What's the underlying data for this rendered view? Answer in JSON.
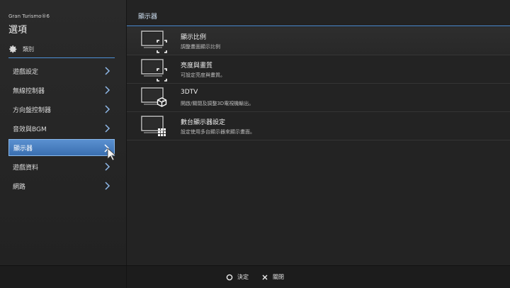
{
  "sidebar": {
    "app_name": "Gran Turismo®6",
    "title": "選項",
    "category_label": "類別",
    "items": [
      {
        "label": "遊戲設定"
      },
      {
        "label": "無線控制器"
      },
      {
        "label": "方向盤控制器"
      },
      {
        "label": "音效與BGM"
      },
      {
        "label": "顯示器",
        "selected": true
      },
      {
        "label": "遊戲資料"
      },
      {
        "label": "網路"
      }
    ]
  },
  "main": {
    "title": "顯示器",
    "options": [
      {
        "title": "顯示比例",
        "desc": "調整畫面顯示比例",
        "icon": "aspect-ratio-icon"
      },
      {
        "title": "亮度與畫質",
        "desc": "可設定亮度與畫質。",
        "icon": "brightness-icon"
      },
      {
        "title": "3DTV",
        "desc": "開啟/關閉及調整3D電視機輸出。",
        "icon": "3d-cube-icon"
      },
      {
        "title": "數台顯示器設定",
        "desc": "設定使用多台顯示器來顯示畫面。",
        "icon": "multi-display-grid-icon"
      }
    ]
  },
  "footer": {
    "confirm_label": "決定",
    "close_label": "關閉"
  },
  "colors": {
    "accent": "#4d8fd6",
    "selected_bg": "#4a80c2",
    "background": "#242424"
  }
}
